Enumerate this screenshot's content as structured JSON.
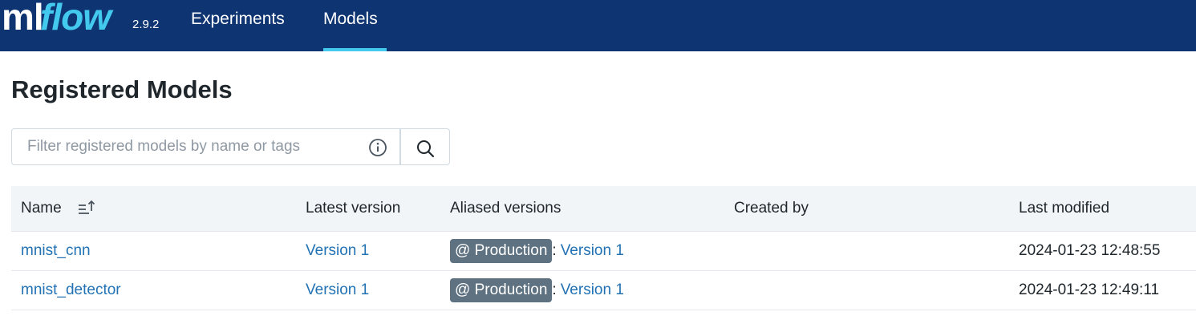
{
  "header": {
    "logo_ml": "ml",
    "logo_flow": "flow",
    "version": "2.9.2",
    "nav": [
      {
        "label": "Experiments",
        "active": false
      },
      {
        "label": "Models",
        "active": true
      }
    ],
    "colors": {
      "background": "#0e3472",
      "accent": "#43c9ed"
    }
  },
  "page": {
    "title": "Registered Models"
  },
  "search": {
    "placeholder": "Filter registered models by name or tags",
    "value": ""
  },
  "table": {
    "columns": [
      "Name",
      "Latest version",
      "Aliased versions",
      "Created by",
      "Last modified"
    ],
    "rows": [
      {
        "name": "mnist_cnn",
        "latest_version": "Version 1",
        "alias": "@ Production",
        "alias_sep": ":",
        "alias_version": "Version 1",
        "created_by": "",
        "last_modified": "2024-01-23 12:48:55"
      },
      {
        "name": "mnist_detector",
        "latest_version": "Version 1",
        "alias": "@ Production",
        "alias_sep": ":",
        "alias_version": "Version 1",
        "created_by": "",
        "last_modified": "2024-01-23 12:49:11"
      }
    ]
  },
  "icons": {
    "info": "info-icon",
    "search": "search-icon",
    "sort": "sort-ascending-icon"
  }
}
